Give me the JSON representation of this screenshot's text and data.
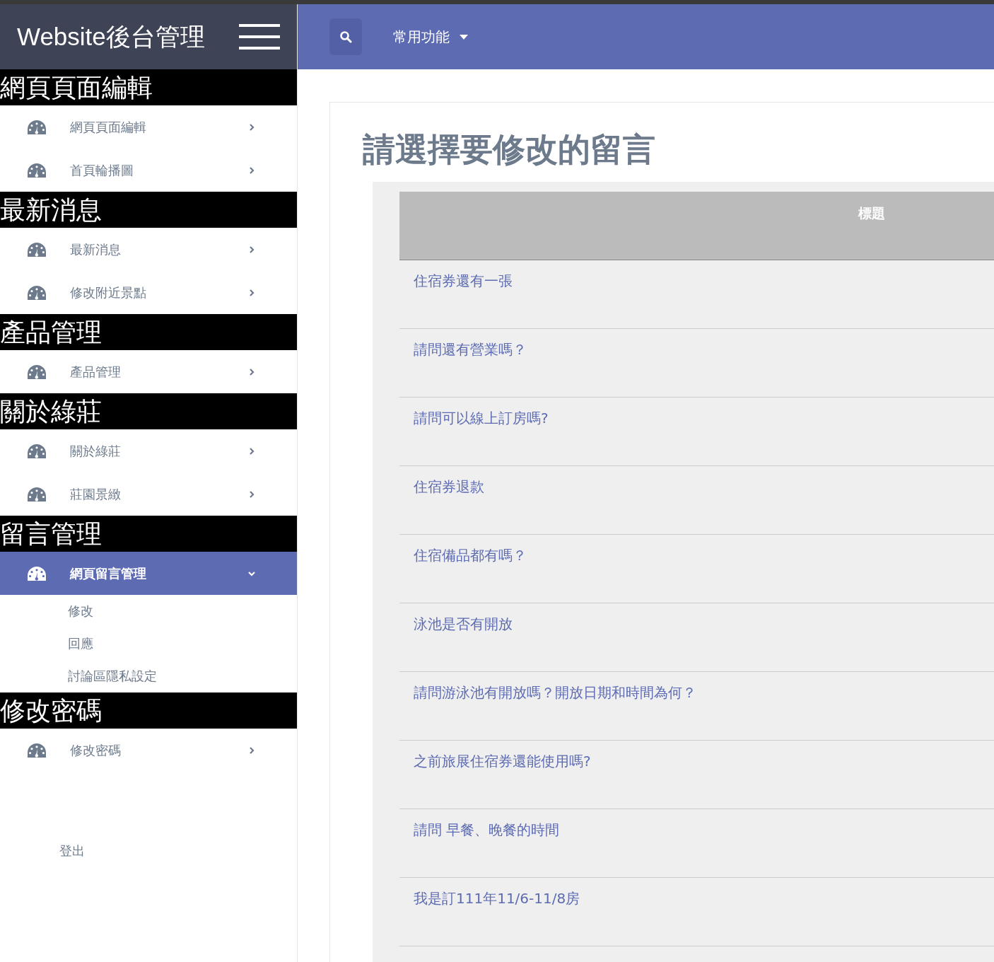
{
  "sidebar": {
    "brand": "Website後台管理",
    "sections": [
      {
        "title": "網頁頁面編輯",
        "items": [
          {
            "label": "網頁頁面編輯",
            "selected": false,
            "expanded": false
          },
          {
            "label": "首頁輪播圖",
            "selected": false,
            "expanded": false
          }
        ]
      },
      {
        "title": "最新消息",
        "items": [
          {
            "label": "最新消息",
            "selected": false,
            "expanded": false
          },
          {
            "label": "修改附近景點",
            "selected": false,
            "expanded": false
          }
        ]
      },
      {
        "title": "產品管理",
        "items": [
          {
            "label": "產品管理",
            "selected": false,
            "expanded": false
          }
        ]
      },
      {
        "title": "關於綠莊",
        "items": [
          {
            "label": "關於綠莊",
            "selected": false,
            "expanded": false
          },
          {
            "label": "莊園景緻",
            "selected": false,
            "expanded": false
          }
        ]
      },
      {
        "title": "留言管理",
        "items": [
          {
            "label": "網頁留言管理",
            "selected": true,
            "expanded": true,
            "children": [
              {
                "label": "修改"
              },
              {
                "label": "回應"
              },
              {
                "label": "討論區隱私設定"
              }
            ]
          }
        ]
      },
      {
        "title": "修改密碼",
        "items": [
          {
            "label": "修改密碼",
            "selected": false,
            "expanded": false
          }
        ]
      }
    ],
    "logout": "登出"
  },
  "topbar": {
    "menu": "常用功能"
  },
  "page": {
    "title": "請選擇要修改的留言",
    "table": {
      "columns": [
        "標題"
      ],
      "rows": [
        "住宿券還有一張",
        "請問還有營業嗎？",
        "請問可以線上訂房嗎?",
        "住宿券退款",
        "住宿備品都有嗎？",
        "泳池是否有開放",
        "請問游泳池有開放嗎？開放日期和時間為何？",
        "之前旅展住宿券還能使用嗎?",
        "請問 早餐、晚餐的時間",
        "我是訂111年11/6-11/8房"
      ]
    }
  }
}
